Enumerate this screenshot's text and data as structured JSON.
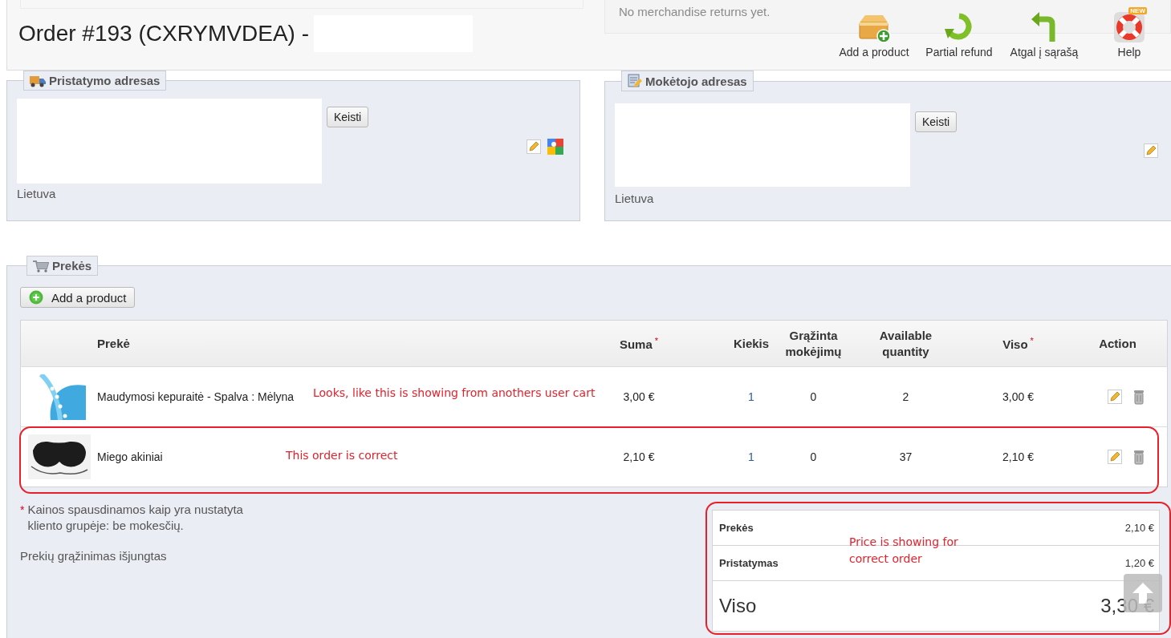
{
  "header": {
    "returns_note": "No merchandise returns yet.",
    "title": "Order #193 (CXRYMVDEA) -",
    "toolbar": [
      {
        "kind": "add",
        "label": "Add a product"
      },
      {
        "kind": "refund",
        "label": "Partial refund"
      },
      {
        "kind": "back",
        "label": "Atgal į sąrašą"
      },
      {
        "kind": "help",
        "label": "Help",
        "badge": "NEW"
      }
    ]
  },
  "addresses": [
    {
      "legend": "Pristatymo adresas",
      "kind": "shipping",
      "button": "Keisti",
      "country": "Lietuva",
      "icons": [
        {
          "kind": "edit"
        },
        {
          "kind": "map"
        }
      ]
    },
    {
      "legend": "Mokėtojo adresas",
      "kind": "invoice",
      "button": "Keisti",
      "country": "Lietuva",
      "icons": [
        {
          "kind": "edit"
        }
      ]
    }
  ],
  "products": {
    "legend": "Prekės",
    "add_button": "Add a product",
    "columns": [
      {
        "label": "Prekė"
      },
      {
        "label": "Suma",
        "marker": "*"
      },
      {
        "label": "Kiekis"
      },
      {
        "label": "Grąžinta mokėjimų"
      },
      {
        "label": "Available quantity"
      },
      {
        "label": "Viso",
        "marker": "*"
      },
      {
        "label": "Action"
      }
    ],
    "rows": [
      {
        "kind": "cap",
        "name": "Maudymosi kepuraitė - Spalva : Mėlyna",
        "price": "3,00 €",
        "quantity": "1",
        "refunded": "0",
        "available": "2",
        "total": "3,00 €"
      },
      {
        "kind": "mask",
        "name": "Miego akiniai",
        "price": "2,10 €",
        "quantity": "1",
        "refunded": "0",
        "available": "37",
        "total": "2,10 €"
      }
    ],
    "note_marker": "*",
    "note": "Kainos spausdinamos kaip yra nustatyta kliento grupėje: be mokesčių.",
    "returns_status": "Prekių grąžinimas išjungtas",
    "totals": [
      {
        "kind": "line",
        "label": "Prekės",
        "value": "2,10 €"
      },
      {
        "kind": "line",
        "label": "Pristatymas",
        "value": "1,20 €"
      },
      {
        "kind": "grand",
        "label": "Viso",
        "value": "3,30 €"
      }
    ]
  },
  "annotations": [
    {
      "text": "Looks, like this is showing from anothers user cart"
    },
    {
      "text": "This order is correct"
    },
    {
      "text": "Price is showing for correct order"
    }
  ]
}
